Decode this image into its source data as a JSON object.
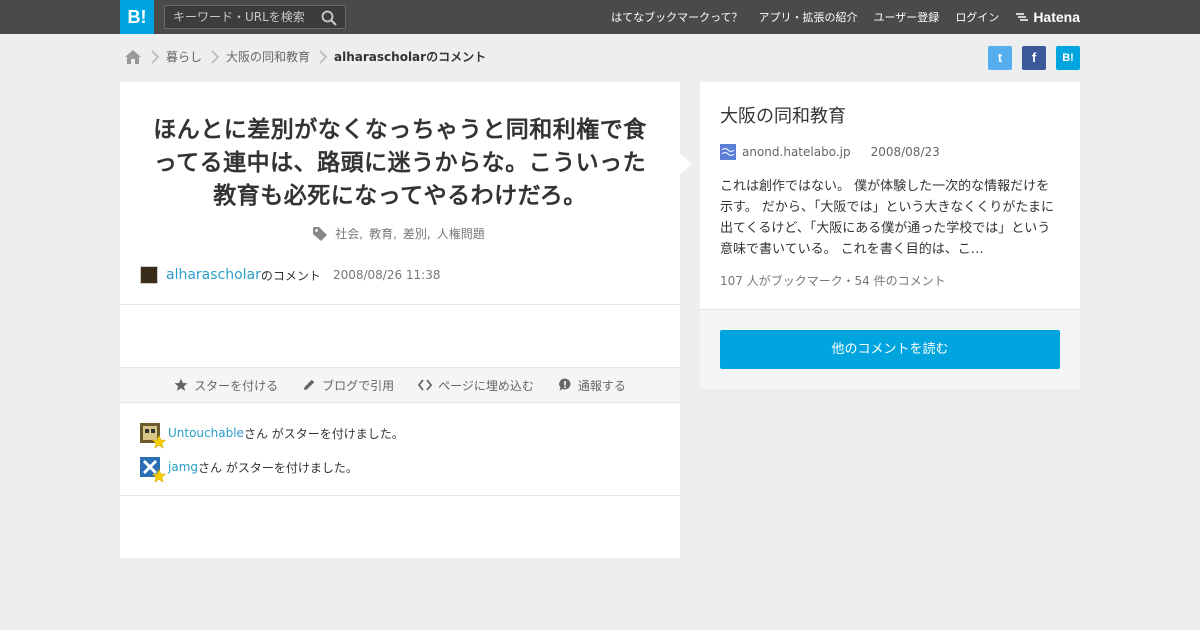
{
  "topbar": {
    "logo": "B!",
    "search_placeholder": "キーワード・URLを検索",
    "nav": [
      "はてなブックマークって？",
      "アプリ・拡張の紹介",
      "ユーザー登録",
      "ログイン"
    ],
    "brand": "Hatena"
  },
  "breadcrumb": {
    "items": [
      "暮らし",
      "大阪の同和教育"
    ],
    "current": "alharascholarのコメント"
  },
  "share": {
    "twitter": "t",
    "facebook": "f",
    "hatena": "B!"
  },
  "comment": {
    "text": "ほんとに差別がなくなっちゃうと同和利権で食ってる連中は、路頭に迷うからな。こういった教育も必死になってやるわけだろ。",
    "tags": [
      "社会,",
      "教育,",
      "差別,",
      "人権問題"
    ],
    "user": "alharascholar",
    "user_suffix": "のコメント",
    "timestamp": "2008/08/26 11:38"
  },
  "actions": [
    "スターを付ける",
    "ブログで引用",
    "ページに埋め込む",
    "通報する"
  ],
  "stars": [
    {
      "user": "Untouchable",
      "msg": "さん がスターを付けました。"
    },
    {
      "user": "jamg",
      "msg": "さん がスターを付けました。"
    }
  ],
  "article": {
    "title": "大阪の同和教育",
    "source": "anond.hatelabo.jp",
    "date": "2008/08/23",
    "summary": "これは創作ではない。 僕が体験した一次的な情報だけを示す。 だから、「大阪では」という大きなくくりがたまに出てくるけど、「大阪にある僕が通った学校では」という意味で書いている。 これを書く目的は、こ…",
    "counts": "107 人がブックマーク・54 件のコメント",
    "more_label": "他のコメントを読む"
  },
  "colors": {
    "accent": "#00a4de",
    "topbar": "#4a4a4a",
    "link": "#2a9ec9"
  }
}
